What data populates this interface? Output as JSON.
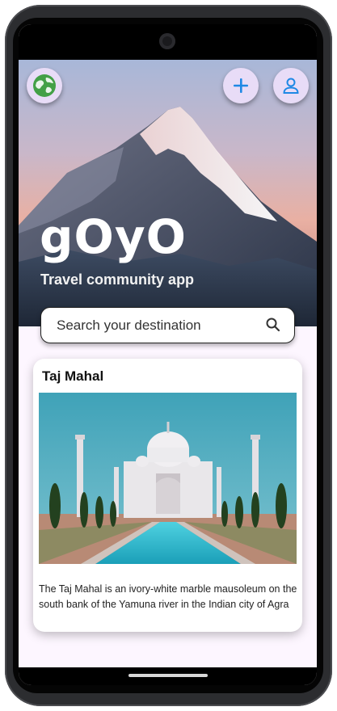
{
  "hero": {
    "title": "gOyO",
    "subtitle": "Travel community app"
  },
  "buttons": {
    "globe_icon": "globe-icon",
    "add_icon": "plus-icon",
    "profile_icon": "user-icon"
  },
  "search": {
    "placeholder": "Search your destination",
    "icon": "search-icon"
  },
  "card": {
    "title": "Taj Mahal",
    "description": "The Taj Mahal is an ivory-white marble mausoleum on the south bank of the Yamuna river in the Indian city of Agra"
  },
  "colors": {
    "accent": "#1e88e5",
    "button_bg": "#e8dcf7",
    "screen_bg": "#fdf6ff"
  }
}
